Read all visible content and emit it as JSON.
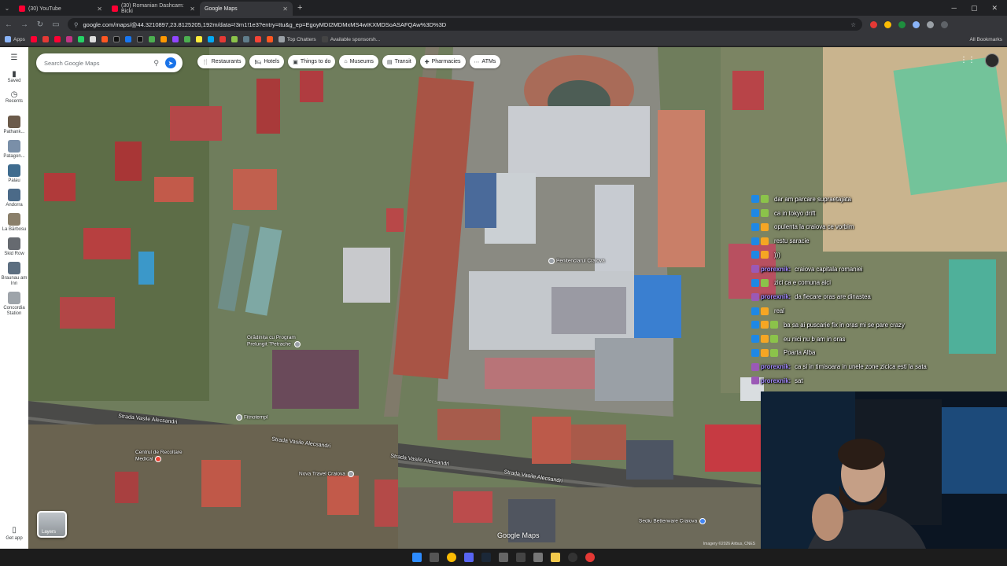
{
  "browser": {
    "tabs": [
      {
        "title": "(30) YouTube",
        "active": false,
        "favicon": "youtube-icon"
      },
      {
        "title": "(30) Romanian Dashcam: Bicki",
        "active": false,
        "favicon": "youtube-icon"
      },
      {
        "title": "Google Maps",
        "active": true,
        "favicon": "maps-icon"
      }
    ],
    "new_tab": "+",
    "url": "google.com/maps/@44.3210897,23.8125205,192m/data=!3m1!1e3?entry=ttu&g_ep=EgoyMDI2MDMxMS4wIKXMDSoASAFQAw%3D%3D",
    "bookmarks": [
      {
        "label": "Apps",
        "color": "#8ab4f8"
      },
      {
        "label": "Top Chatters",
        "color": "#9aa0a6"
      },
      {
        "label": "Available sponsorsh...",
        "color": "#444"
      }
    ],
    "bookmarks_all": "All Bookmarks"
  },
  "maps": {
    "search_placeholder": "Search Google Maps",
    "chips": [
      {
        "label": "Restaurants",
        "icon": "restaurant-icon",
        "glyph": "🍴"
      },
      {
        "label": "Hotels",
        "icon": "hotel-icon",
        "glyph": "🛏"
      },
      {
        "label": "Things to do",
        "icon": "camera-icon",
        "glyph": "▣"
      },
      {
        "label": "Museums",
        "icon": "museum-icon",
        "glyph": "⌂"
      },
      {
        "label": "Transit",
        "icon": "transit-icon",
        "glyph": "▤"
      },
      {
        "label": "Pharmacies",
        "icon": "pharmacy-icon",
        "glyph": "✚"
      },
      {
        "label": "ATMs",
        "icon": "more-icon",
        "glyph": "⋯"
      }
    ],
    "rail": {
      "menu": "☰",
      "saved": "Saved",
      "recents": "Recents",
      "places": [
        {
          "label": "Pathank...",
          "color": "#6b5a4a"
        },
        {
          "label": "Patagon...",
          "color": "#7a8fa8"
        },
        {
          "label": "Palau",
          "color": "#3f6c8f"
        },
        {
          "label": "Andorra",
          "color": "#4b6a88"
        },
        {
          "label": "La Bărbosu",
          "color": "#8a7f6a"
        },
        {
          "label": "Skid Row",
          "color": "#666a70"
        },
        {
          "label": "Braunau am Inn",
          "color": "#5c6e80"
        },
        {
          "label": "Concordia Station",
          "color": "#9ea4aa"
        }
      ],
      "get_app": "Get app"
    },
    "labels": {
      "penitentiary": "Penitenciarul Craiova",
      "kindergarten": "Grădinița cu Program Prelungit \"Petrache",
      "fitness": "Fitnotempl",
      "medical": "Centrul de Recoltare Medical",
      "travel": "Nova Travel Craiova",
      "betting": "Sediu Betterware Craiova",
      "street1": "Strada Vasile Alecsandri",
      "street2": "Strada Vasile Alecsandri",
      "street3": "Strada Vasile Alecsandri",
      "street4": "Strada Vasile Alecsandri"
    },
    "layers_label": "Layers",
    "logo": "Google Maps",
    "imagery": "Imagery ©2026 Airbus, CNES"
  },
  "chat": [
    {
      "user": "",
      "text": "dar am parcare supraetajata",
      "name_color": "#7cf2a0"
    },
    {
      "user": "",
      "text": "ca in tokyo drift",
      "name_color": "#ff9933"
    },
    {
      "user": "",
      "text": "opulenta la craiova ce vorbim",
      "name_color": "#ff5e5e"
    },
    {
      "user": "",
      "text": "restu saracie",
      "name_color": "#ff5e5e"
    },
    {
      "user": "",
      "text": ")))",
      "name_color": "#ff5e5e"
    },
    {
      "user": "prorexnik:",
      "text": "craiova capitala romaniei",
      "name_color": "#a48bff"
    },
    {
      "user": "",
      "text": "zici ca e comuna aici",
      "name_color": "#5ac8fa"
    },
    {
      "user": "prorexnik:",
      "text": "da fiecare oras are dinastea",
      "name_color": "#a48bff"
    },
    {
      "user": "",
      "text": "real",
      "name_color": "#ff5e5e"
    },
    {
      "user": "",
      "text": "ba sa ai puscarie fix in oras mi se pare crazy",
      "name_color": "#ff9933"
    },
    {
      "user": "",
      "text": "eu nici nu b am in oras",
      "name_color": "#ff9933"
    },
    {
      "user": "",
      "text": "Poarta Alba",
      "name_color": "#ff9933"
    },
    {
      "user": "prorexnik:",
      "text": "ca si in timisoara in unele zone zicica esti la sata",
      "name_color": "#a48bff"
    },
    {
      "user": "prorexnik:",
      "text": "sat",
      "name_color": "#a48bff"
    }
  ]
}
